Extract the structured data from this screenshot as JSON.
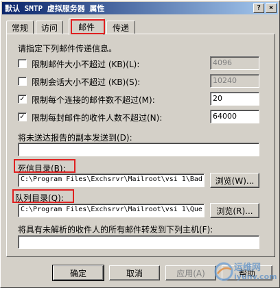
{
  "window": {
    "title": "默认 SMTP 虚拟服务器 属性",
    "help_btn": "?",
    "close_btn": "×"
  },
  "tabs": [
    {
      "label": "常规"
    },
    {
      "label": "访问"
    },
    {
      "label": "邮件",
      "active": true
    },
    {
      "label": "传递"
    }
  ],
  "panel": {
    "intro": "请指定下列邮件传递信息。",
    "limits": [
      {
        "label": "限制邮件大小不超过 (KB)(L):",
        "checked": false,
        "value": "4096",
        "enabled": false
      },
      {
        "label": "限制会话大小不超过 (KB)(S):",
        "checked": false,
        "value": "10240",
        "enabled": false
      },
      {
        "label": "限制每个连接的邮件数不超过(M):",
        "checked": true,
        "check_mark": "✓",
        "value": "20",
        "enabled": true
      },
      {
        "label": "限制每封邮件的收件人数不超过(N):",
        "checked": true,
        "check_mark": "✓",
        "value": "64000",
        "enabled": true
      }
    ],
    "ndr_copy_label": "将未送达报告的副本发送到(D):",
    "ndr_copy_value": "",
    "badmail_label": "死信目录(B):",
    "badmail_value": "C:\\Program Files\\Exchsrvr\\Mailroot\\vsi 1\\Bad",
    "badmail_browse": "浏览(W)...",
    "queue_label": "队列目录(Q):",
    "queue_value": "C:\\Program Files\\Exchsrvr\\Mailroot\\vsi 1\\Que",
    "queue_browse": "浏览(R)...",
    "forward_label": "将具有未解析的收件人的所有邮件转发到下列主机(F):",
    "forward_value": ""
  },
  "footer": {
    "ok": "确定",
    "cancel": "取消",
    "apply": "应用(A)",
    "help": "帮助"
  },
  "watermark": {
    "line1": "运维网",
    "line2": "iyunv.com"
  },
  "colors": {
    "face": "#d4d0c8",
    "title_bar": "#0a246a",
    "highlight_box": "#e02020"
  }
}
